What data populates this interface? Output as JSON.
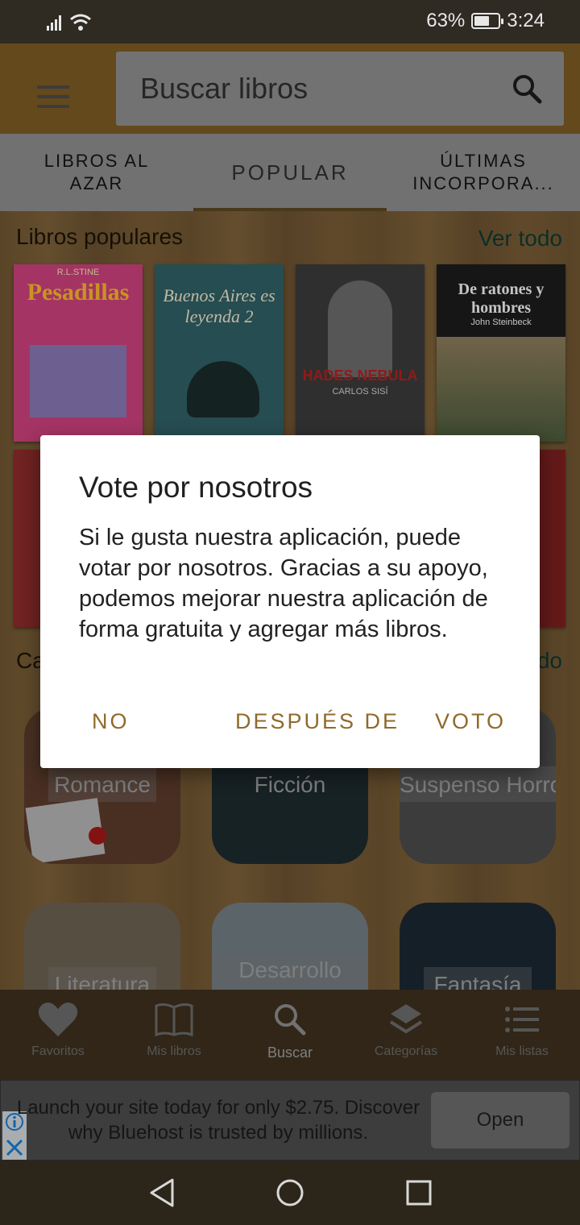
{
  "status_bar": {
    "battery_text": "63%",
    "battery_level": 0.63,
    "time": "3:24"
  },
  "search": {
    "placeholder": "Buscar libros"
  },
  "tabs": [
    {
      "label": "LIBROS AL\nAZAR"
    },
    {
      "label": "POPULAR"
    },
    {
      "label": "ÚLTIMAS\nINCORPORA..."
    }
  ],
  "popular": {
    "title": "Libros populares",
    "see_all": "Ver todo",
    "books": [
      {
        "title": "Pesadillas",
        "author": "R.L.STINE",
        "color": "#c9407a"
      },
      {
        "title": "Buenos Aires es leyenda 2",
        "author": "",
        "color": "#2f5f63"
      },
      {
        "title": "HADES NEBULA",
        "author": "CARLOS SISÍ",
        "color": "#3a3a3a"
      },
      {
        "title": "De ratones y hombres",
        "author": "John Steinbeck",
        "color": "#1c1c1c"
      }
    ]
  },
  "categories": {
    "title_partial": "Ca",
    "see_all_partial": "do",
    "items": [
      {
        "label": "Romance",
        "color": "#5a3a2a"
      },
      {
        "label": "Ficción",
        "color": "#1d2a2e"
      },
      {
        "label": "Suspenso Horror",
        "color": "#4a4a4a"
      },
      {
        "label": "Literatura",
        "color": "#6a6050"
      },
      {
        "label": "Desarrollo",
        "color": "#6f7a80"
      },
      {
        "label": "Fantasía",
        "color": "#1a2630"
      }
    ]
  },
  "bottom_nav": [
    {
      "label": "Favoritos",
      "icon": "heart-icon"
    },
    {
      "label": "Mis libros",
      "icon": "book-icon"
    },
    {
      "label": "Buscar",
      "icon": "search-icon"
    },
    {
      "label": "Categorías",
      "icon": "layers-icon"
    },
    {
      "label": "Mis listas",
      "icon": "list-icon"
    }
  ],
  "ad": {
    "text": "Launch your site today for only $2.75. Discover why Bluehost is trusted by millions.",
    "button": "Open"
  },
  "dialog": {
    "title": "Vote por nosotros",
    "body": "Si le gusta nuestra aplicación, puede votar por nosotros. Gracias a su apoyo, podemos mejorar nuestra aplicación de forma gratuita y agregar más libros.",
    "buttons": {
      "no": "NO",
      "later": "DESPUÉS DE",
      "vote": "VOTO"
    }
  },
  "colors": {
    "accent": "#8f6a2a",
    "app_bar": "#7b5a24"
  }
}
